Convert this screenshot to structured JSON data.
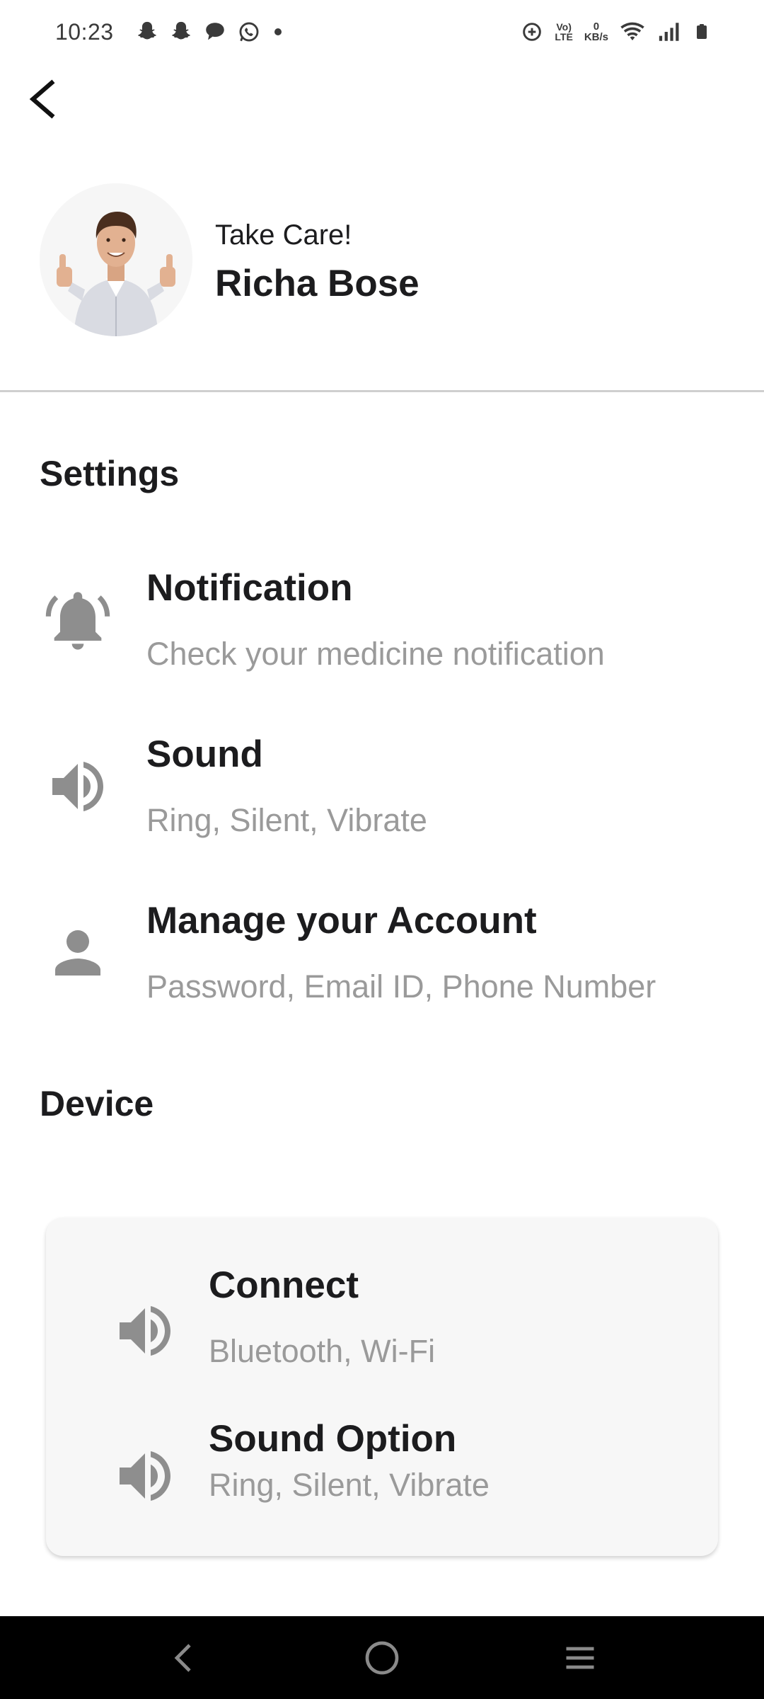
{
  "status_bar": {
    "time": "10:23",
    "notification_icons": [
      "snapchat-icon",
      "snapchat-icon",
      "chat-bubble-icon",
      "whatsapp-icon",
      "dot-icon"
    ],
    "volte_top": "Vo)",
    "volte_bottom": "LTE",
    "net_speed_value": "0",
    "net_speed_unit": "KB/s"
  },
  "header": {
    "greeting": "Take Care!",
    "user_name": "Richa Bose"
  },
  "settings": {
    "title": "Settings",
    "items": [
      {
        "icon": "bell-icon",
        "title": "Notification",
        "subtitle": "Check your medicine notification"
      },
      {
        "icon": "speaker-icon",
        "title": "Sound",
        "subtitle": "Ring, Silent, Vibrate"
      },
      {
        "icon": "person-icon",
        "title": "Manage your Account",
        "subtitle": "Password, Email ID, Phone Number"
      }
    ]
  },
  "device": {
    "title": "Device",
    "items": [
      {
        "icon": "speaker-icon",
        "title": "Connect",
        "subtitle": "Bluetooth, Wi-Fi"
      },
      {
        "icon": "speaker-icon",
        "title": "Sound Option",
        "subtitle": "Ring, Silent, Vibrate"
      }
    ]
  },
  "colors": {
    "text_primary": "#1c1c1e",
    "text_secondary": "#9a9a9a",
    "icon_gray": "#8e8e8e",
    "card_background": "#f7f7f7",
    "nav_bar": "#000000"
  }
}
